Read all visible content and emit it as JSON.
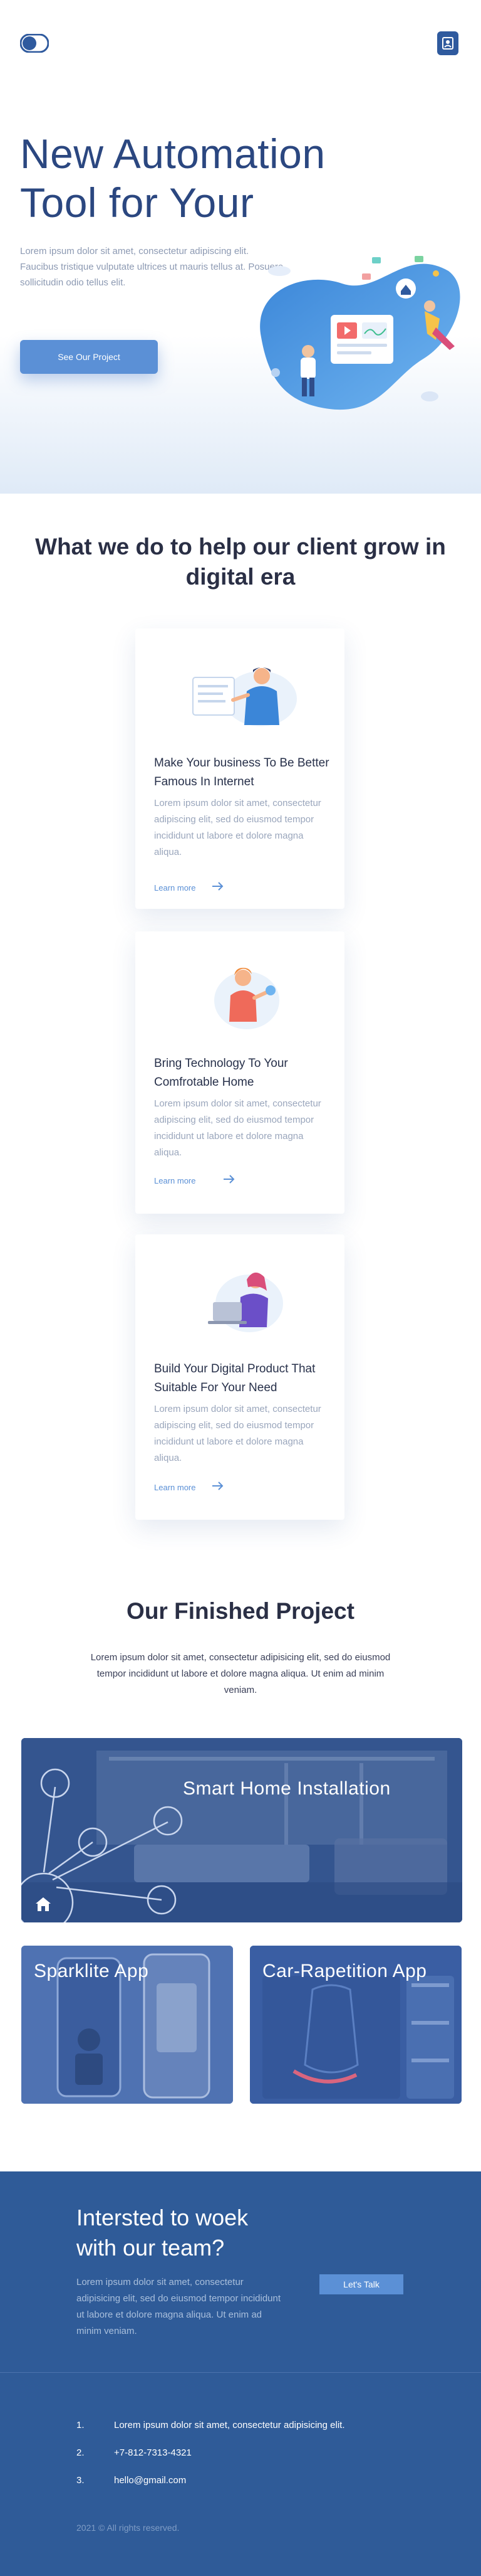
{
  "hero": {
    "title": "New Automation Tool for Your",
    "text": "Lorem ipsum dolor sit amet, consectetur adipiscing elit. Faucibus tristique vulputate ultrices ut mauris tellus at. Posuere sollicitudin odio tellus elit.",
    "cta_label": "See Our Project"
  },
  "services": {
    "title": "What we do to help our client grow in digital era",
    "cards": [
      {
        "title": "Make Your business To Be Better Famous In Internet",
        "text": "Lorem ipsum dolor sit amet, consectetur adipiscing elit, sed do eiusmod tempor incididunt ut labore et dolore magna aliqua.",
        "link": "Learn more"
      },
      {
        "title": "Bring Technology To Your Comfrotable Home",
        "text": "Lorem ipsum dolor sit amet, consectetur adipiscing elit, sed do eiusmod tempor incididunt ut labore et dolore magna aliqua.",
        "link": "Learn more"
      },
      {
        "title": "Build Your Digital Product That Suitable For Your Need",
        "text": "Lorem ipsum dolor sit amet, consectetur adipiscing elit, sed do eiusmod tempor incididunt ut labore et dolore magna aliqua.",
        "link": "Learn more"
      }
    ]
  },
  "projects": {
    "title": "Our Finished Project",
    "text": "Lorem ipsum dolor sit amet, consectetur adipisicing elit, sed do eiusmod tempor incididunt ut labore et dolore magna aliqua. Ut enim ad minim veniam.",
    "items": [
      {
        "label": "Smart Home Installation"
      },
      {
        "label": "Sparklite App"
      },
      {
        "label": "Car-Rapetition App"
      }
    ]
  },
  "footer": {
    "cta_title": "Intersted to woek with our team?",
    "cta_text": "Lorem ipsum dolor sit amet, consectetur adipisicing elit, sed do eiusmod tempor incididunt ut labore et dolore magna aliqua. Ut enim ad minim veniam.",
    "cta_button": "Let's Talk",
    "contacts": [
      {
        "num": "1.",
        "value": "Lorem ipsum dolor sit amet, consectetur adipisicing elit."
      },
      {
        "num": "2.",
        "value": "+7-812-7313-4321"
      },
      {
        "num": "3.",
        "value": "hello@gmail.com"
      }
    ],
    "copyright": "2021 © All rights reserved."
  },
  "colors": {
    "primary": "#2f5b98",
    "accent": "#5b90d6",
    "heading": "#2b4780",
    "muted": "#9aa6bc"
  },
  "icons": {
    "logo": "toggle-logo-icon",
    "menu": "menu-icon",
    "arrow": "arrow-right-icon",
    "home": "home-icon"
  }
}
